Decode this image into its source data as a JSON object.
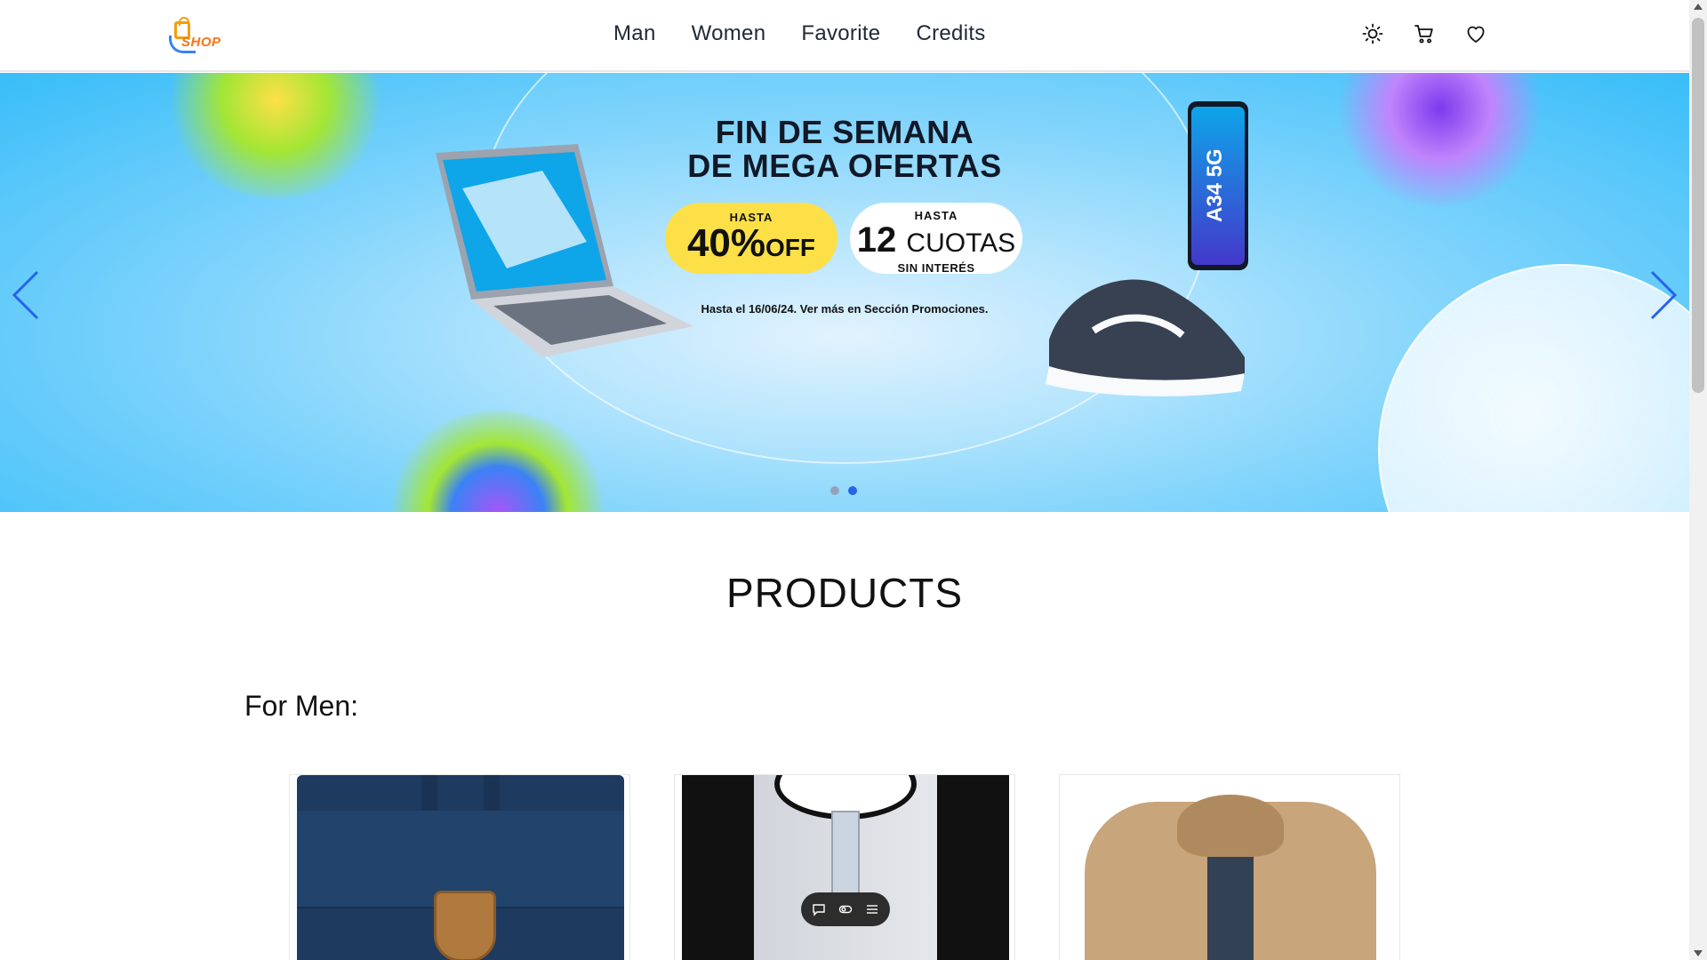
{
  "header": {
    "logo_text": "SHOP",
    "nav": [
      {
        "label": "Man"
      },
      {
        "label": "Women"
      },
      {
        "label": "Favorite"
      },
      {
        "label": "Credits"
      }
    ],
    "icons": [
      "sun-icon",
      "cart-icon",
      "heart-icon"
    ]
  },
  "hero": {
    "headline_line1": "FIN DE SEMANA",
    "headline_line2": "DE MEGA OFERTAS",
    "off_small": "HASTA",
    "off_big": "40%",
    "off_suffix": "OFF",
    "cuotas_small": "HASTA",
    "cuotas_number": "12",
    "cuotas_word": "CUOTAS",
    "cuotas_tiny": "SIN INTERÉS",
    "phone_label": "A34 5G",
    "terms": "Hasta el 16/06/24. Ver más en Sección Promociones.",
    "slides": 2,
    "active_slide": 2,
    "colors": {
      "accent": "#2563eb",
      "badge_yellow": "#fde047"
    }
  },
  "products": {
    "title": "PRODUCTS",
    "section_label": "For Men:",
    "items": [
      {
        "name": "backpack"
      },
      {
        "name": "henley-shirt"
      },
      {
        "name": "jacket"
      }
    ]
  },
  "toolbar": {
    "icons": [
      "chat-icon",
      "toggle-icon",
      "list-icon"
    ]
  }
}
